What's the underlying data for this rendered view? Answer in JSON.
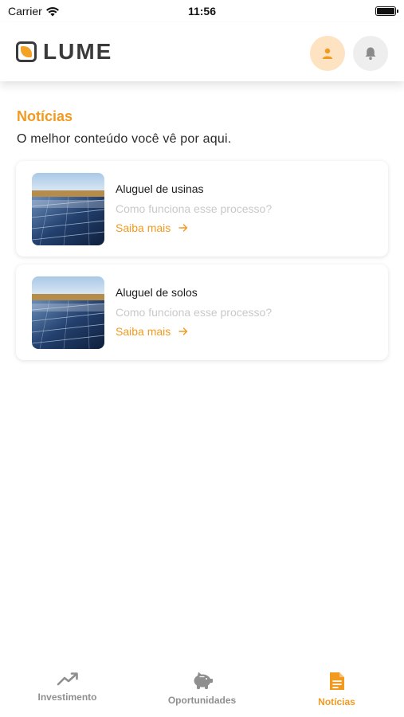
{
  "status_bar": {
    "carrier": "Carrier",
    "time": "11:56"
  },
  "header": {
    "logo_text": "LUME",
    "profile_icon": "person-icon",
    "notification_icon": "bell-icon"
  },
  "page": {
    "title": "Notícias",
    "subtitle": "O melhor conteúdo você vê por aqui."
  },
  "cards": [
    {
      "title": "Aluguel de usinas",
      "description": "Como funciona esse processo?",
      "link": "Saiba mais",
      "image": "solar-panels-photo"
    },
    {
      "title": "Aluguel de solos",
      "description": "Como funciona esse processo?",
      "link": "Saiba mais",
      "image": "solar-panels-photo"
    }
  ],
  "bottom_nav": {
    "items": [
      {
        "label": "Investimento",
        "icon": "trending-up-icon",
        "active": false
      },
      {
        "label": "Oportunidades",
        "icon": "piggy-bank-icon",
        "active": false
      },
      {
        "label": "Notícias",
        "icon": "document-icon",
        "active": true
      }
    ]
  },
  "colors": {
    "accent": "#f29a1f",
    "accent_light": "#fde3c2",
    "muted": "#8f8f8f",
    "dark": "#3a3a3a"
  }
}
